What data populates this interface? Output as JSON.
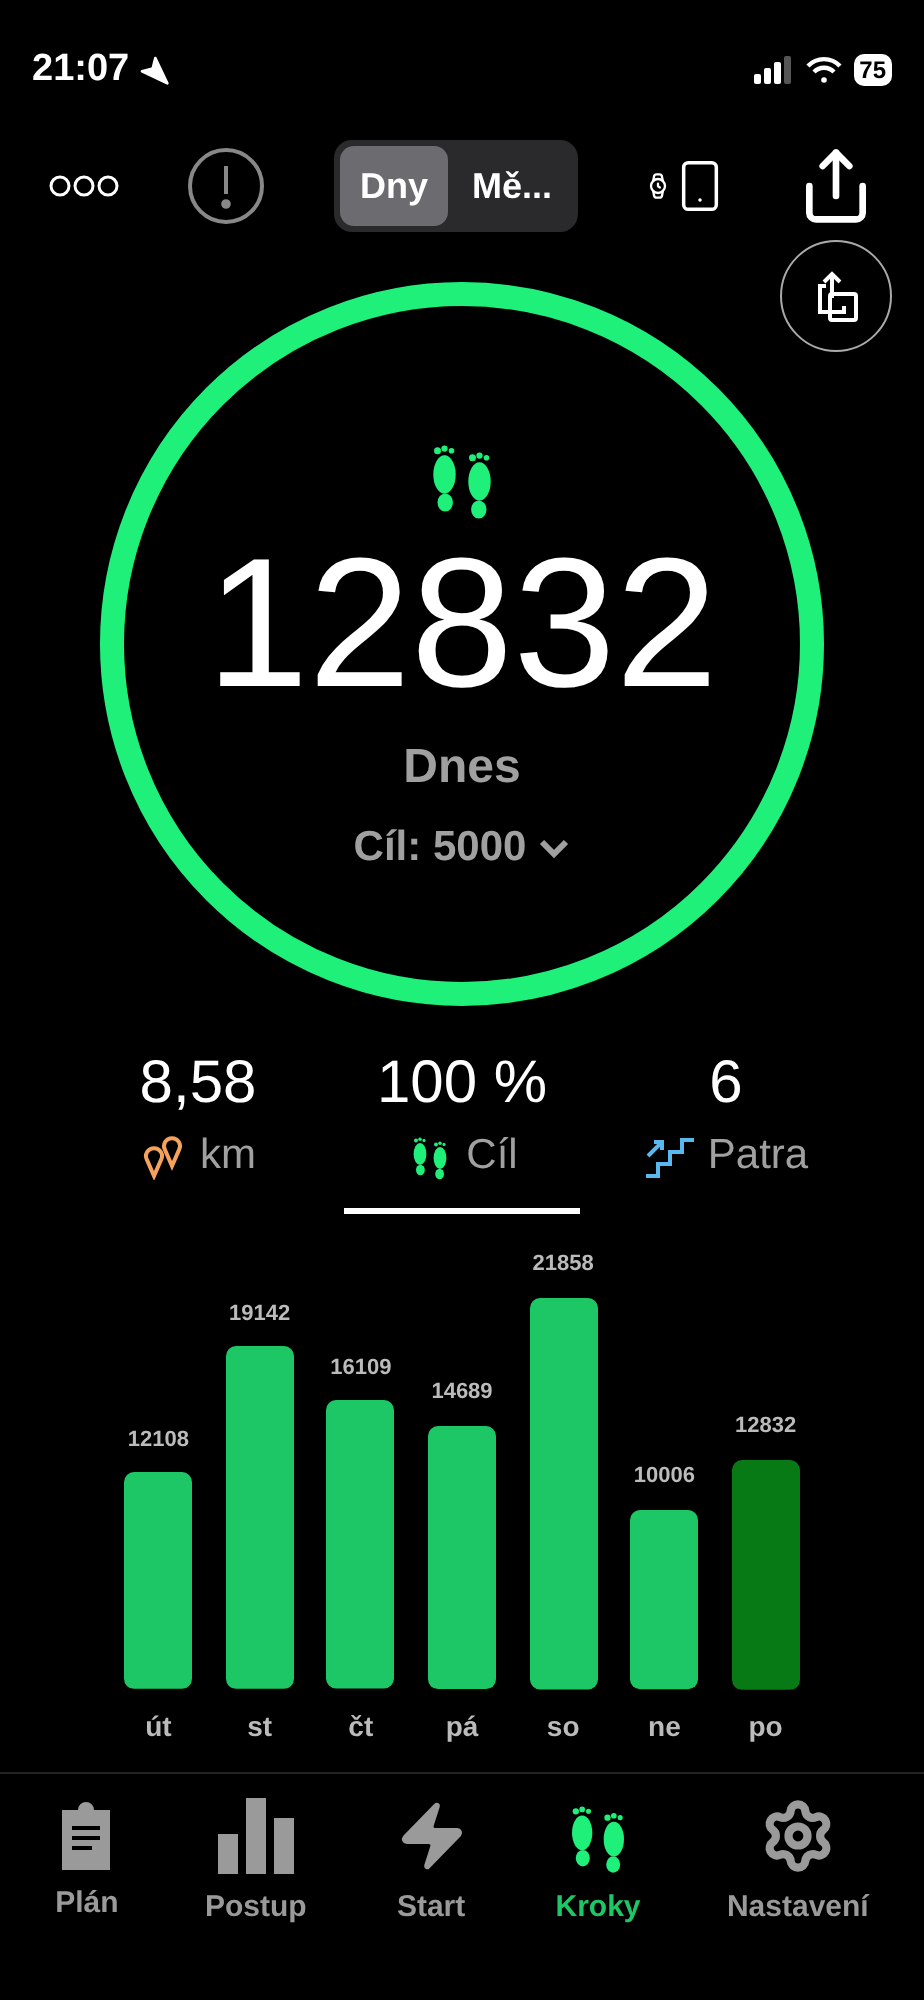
{
  "status_bar": {
    "time": "21:07",
    "battery": "75"
  },
  "toolbar": {
    "segments": [
      {
        "label": "Dny",
        "selected": true
      },
      {
        "label": "Mě...",
        "selected": false
      }
    ]
  },
  "ring": {
    "level": 1,
    "steps": "12832",
    "day": "Dnes",
    "goal": "Cíl: 5000"
  },
  "stats": [
    {
      "kind": "distance",
      "value": "8,58",
      "label": "km",
      "selected": false
    },
    {
      "kind": "goal",
      "value": "100 %",
      "label": "Cíl",
      "selected": true
    },
    {
      "kind": "floors",
      "value": "6",
      "label": "Patra",
      "selected": false
    }
  ],
  "chart_data": {
    "type": "bar",
    "categories": [
      "út",
      "st",
      "čt",
      "pá",
      "so",
      "ne",
      "po"
    ],
    "data_labels": true,
    "ylim": [
      0,
      22000
    ],
    "series": [
      {
        "color": "#1ec765",
        "values": [
          12108,
          19142,
          16109,
          14689,
          21858,
          10006,
          null
        ]
      },
      {
        "color": "#087a15",
        "values": [
          null,
          null,
          null,
          null,
          null,
          null,
          12832
        ]
      }
    ]
  },
  "tab_bar": [
    {
      "kind": "plan",
      "label": "Plán",
      "selected": false
    },
    {
      "kind": "progress",
      "label": "Postup",
      "selected": false
    },
    {
      "kind": "start",
      "label": "Start",
      "selected": false
    },
    {
      "kind": "steps",
      "label": "Kroky",
      "selected": true
    },
    {
      "kind": "settings",
      "label": "Nastavení",
      "selected": false
    }
  ]
}
